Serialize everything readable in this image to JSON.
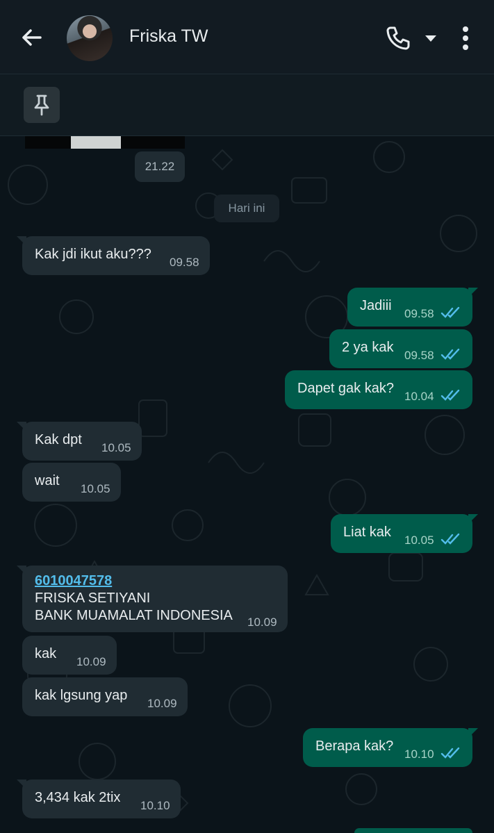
{
  "header": {
    "contact_name": "Friska TW",
    "back_icon": "arrow-left-icon",
    "call_icon": "phone-icon",
    "dropdown_icon": "caret-down-icon",
    "menu_icon": "more-vert-icon"
  },
  "pinned": {
    "icon": "pin-icon"
  },
  "chat": {
    "prev_time": "21.22",
    "date_label": "Hari ini",
    "messages": [
      {
        "dir": "in",
        "text": "Kak jdi ikut aku???",
        "time": "09.58"
      },
      {
        "dir": "out",
        "text": "Jadiii",
        "time": "09.58",
        "read": true
      },
      {
        "dir": "out",
        "text": "2 ya kak",
        "time": "09.58",
        "read": true
      },
      {
        "dir": "out",
        "text": "Dapet gak kak?",
        "time": "10.04",
        "read": true
      },
      {
        "dir": "in",
        "text": "Kak dpt",
        "time": "10.05"
      },
      {
        "dir": "in",
        "text": "wait",
        "time": "10.05"
      },
      {
        "dir": "out",
        "text": "Liat kak",
        "time": "10.05",
        "read": true
      },
      {
        "dir": "in",
        "link": "6010047578",
        "line2": "FRISKA SETIYANI",
        "line3": "BANK MUAMALAT INDONESIA",
        "time": "10.09"
      },
      {
        "dir": "in",
        "text": "kak",
        "time": "10.09"
      },
      {
        "dir": "in",
        "text": "kak lgsung yap",
        "time": "10.09"
      },
      {
        "dir": "out",
        "text": "Berapa kak?",
        "time": "10.10",
        "read": true
      },
      {
        "dir": "in",
        "text": "3,434 kak 2tix",
        "time": "10.10"
      }
    ]
  },
  "colors": {
    "background": "#0b141a",
    "header": "#121b22",
    "incoming_bubble": "#202c33",
    "outgoing_bubble": "#005c4b",
    "read_ticks": "#53bdeb",
    "link": "#53bdeb"
  }
}
